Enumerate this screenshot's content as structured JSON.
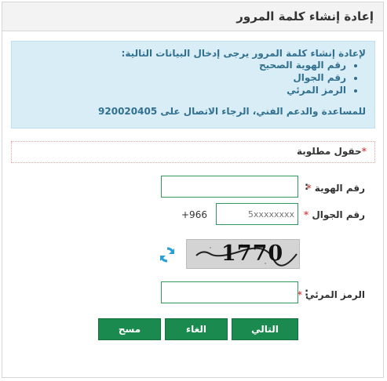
{
  "header": {
    "title": "إعادة إنشاء كلمة المرور"
  },
  "info": {
    "intro": "لإعادة إنشاء كلمة المرور يرجى إدخال البيانات التالية:",
    "items": [
      "رقم الهوية الصحيح",
      "رقم الجوال",
      "الرمز المرئي"
    ],
    "support": "للمساعدة والدعم الفني، الرجاء الاتصال على 920020405"
  },
  "required_note": {
    "star": "*",
    "text": "حقول مطلوبة"
  },
  "form": {
    "id_label": "رقم الهوية",
    "id_value": "",
    "mobile_label": "رقم الجوال",
    "mobile_prefix": "+966",
    "mobile_placeholder": "5xxxxxxxx",
    "captcha_text": "1770",
    "captcha_label": "الرمز المرئي",
    "captcha_value": "",
    "colon": ":",
    "star": "*"
  },
  "buttons": {
    "next": "التالي",
    "cancel": "الغاء",
    "clear": "مسح"
  },
  "colors": {
    "accent": "#1a8a4e",
    "refresh_icon": "#2a9fd6",
    "info_bg": "#d9edf7"
  }
}
